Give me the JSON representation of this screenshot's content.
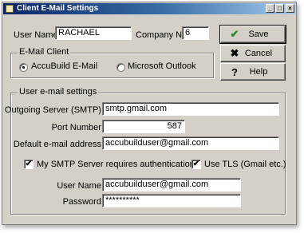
{
  "window": {
    "title": "Client E-Mail Settings",
    "controls": {
      "minimize": "_",
      "maximize": "□",
      "close": "×"
    }
  },
  "form": {
    "user_name_label": "User Name:",
    "user_name_value": "RACHAEL",
    "company_no_label": "Company No:",
    "company_no_value": "6"
  },
  "email_client": {
    "group_label": "E-Mail Client",
    "options": [
      {
        "label": "AccuBuild E-Mail",
        "checked": true
      },
      {
        "label": "Microsoft Outlook",
        "checked": false
      }
    ]
  },
  "user_email_settings": {
    "group_label": "User e-mail settings",
    "outgoing_server_label": "Outgoing Server (SMTP):",
    "outgoing_server_value": "smtp.gmail.com",
    "port_label": "Port Number:",
    "port_value": "587",
    "default_address_label": "Default e-mail address:",
    "default_address_value": "accubuilduser@gmail.com",
    "requires_auth_label": "My SMTP Server requires authentication",
    "requires_auth_checked": true,
    "use_tls_label": "Use TLS (Gmail etc.)",
    "use_tls_checked": true,
    "auth_user_label": "User Name:",
    "auth_user_value": "accubuilduser@gmail.com",
    "password_label": "Password:",
    "password_value": "**********"
  },
  "buttons": {
    "save": {
      "label": "Save",
      "icon": "checkmark-icon",
      "glyph": "✔"
    },
    "cancel": {
      "label": "Cancel",
      "icon": "cancel-x-icon",
      "glyph": "✖"
    },
    "help": {
      "label": "Help",
      "icon": "question-icon",
      "glyph": "?"
    }
  },
  "colors": {
    "dialog_face": "#d4d0c8",
    "titlebar_start": "#0a246a",
    "titlebar_end": "#a6caf0"
  }
}
